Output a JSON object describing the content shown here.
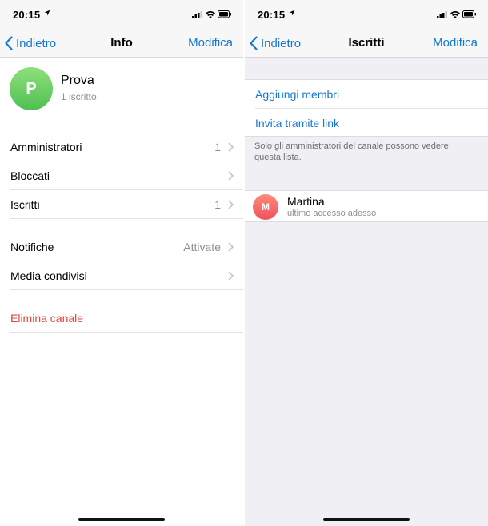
{
  "left": {
    "status": {
      "time": "20:15"
    },
    "nav": {
      "back": "Indietro",
      "title": "Info",
      "action": "Modifica"
    },
    "profile": {
      "initial": "P",
      "name": "Prova",
      "subtitle": "1 iscritto"
    },
    "rows": [
      {
        "label": "Amministratori",
        "value": "1"
      },
      {
        "label": "Bloccati",
        "value": ""
      },
      {
        "label": "Iscritti",
        "value": "1"
      },
      {
        "label": "Notifiche",
        "value": "Attivate"
      },
      {
        "label": "Media condivisi",
        "value": ""
      }
    ],
    "delete": "Elimina canale"
  },
  "right": {
    "status": {
      "time": "20:15"
    },
    "nav": {
      "back": "Indietro",
      "title": "Iscritti",
      "action": "Modifica"
    },
    "actions": [
      {
        "label": "Aggiungi membri"
      },
      {
        "label": "Invita tramite link"
      }
    ],
    "note": "Solo gli amministratori del canale possono vedere questa lista.",
    "member": {
      "initial": "M",
      "name": "Martina",
      "status": "ultimo accesso adesso"
    }
  },
  "colors": {
    "accent": "#1577d4",
    "danger": "#e0453b",
    "avatar_green": "#4fbf52",
    "avatar_red": "#f0525c"
  }
}
